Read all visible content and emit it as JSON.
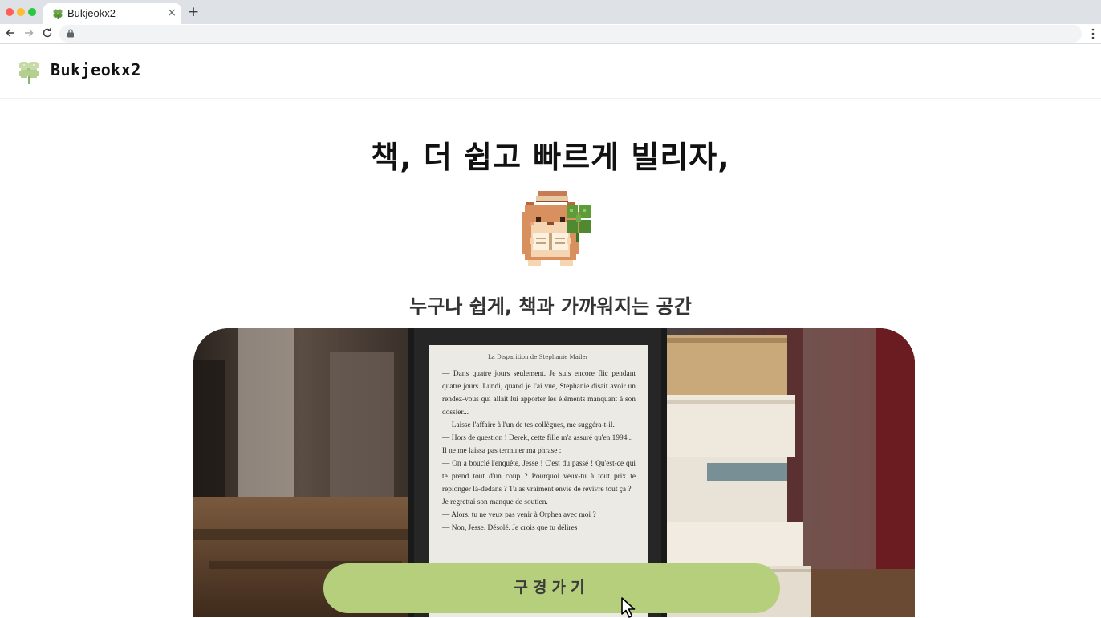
{
  "browser": {
    "tab_title": "Bukjeokx2",
    "tab_icon": "clover-icon",
    "tab_close": "×",
    "new_tab": "+",
    "address": ""
  },
  "header": {
    "site_name": "Bukjeokx2",
    "logo_icon": "clover-icon"
  },
  "hero": {
    "title": "책, 더 쉽고 빠르게 빌리자,",
    "mascot_icon": "hamster-reading-mascot",
    "subtitle": "누구나 쉽게, 책과 가까워지는 공간",
    "cta_label": "구경가기"
  },
  "ereader": {
    "heading": "La Disparition de Stephanie Mailer",
    "paragraphs": [
      "— Dans quatre jours seulement. Je suis encore flic pendant quatre jours. Lundi, quand je l'ai vue, Stephanie disait avoir un rendez-vous qui allait lui apporter les éléments manquant à son dossier...",
      "— Laisse l'affaire à l'un de tes collègues, me suggéra-t-il.",
      "— Hors de question ! Derek, cette fille m'a assuré qu'en 1994...",
      "Il ne me laissa pas terminer ma phrase :",
      "— On a bouclé l'enquête, Jesse ! C'est du passé ! Qu'est-ce qui te prend tout d'un coup ? Pourquoi veux-tu à tout prix te replonger là-dedans ? Tu as vraiment envie de revivre tout ça ?",
      "Je regrettai son manque de soutien.",
      "— Alors, tu ne veux pas venir à Orphea avec moi ?",
      "— Non, Jesse. Désolé. Je crois que tu délires"
    ]
  },
  "colors": {
    "accent_green": "#b6cf7c",
    "text_dark": "#111111"
  }
}
